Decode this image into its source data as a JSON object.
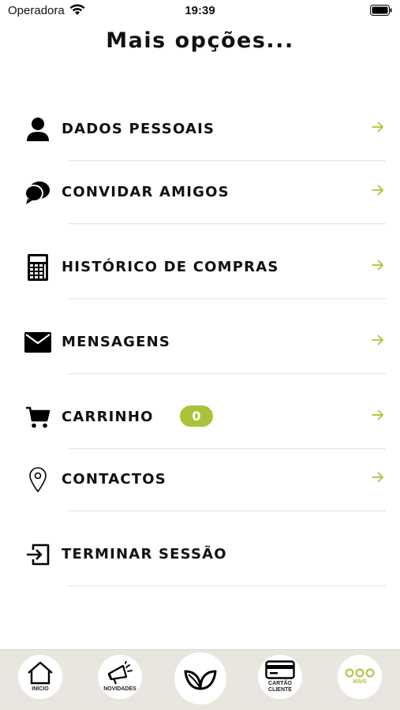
{
  "status_bar": {
    "carrier": "Operadora",
    "time": "19:39"
  },
  "page": {
    "title": "Mais opções..."
  },
  "menu": {
    "items": [
      {
        "label": "DADOS PESSOAIS",
        "icon": "person-icon"
      },
      {
        "label": "CONVIDAR AMIGOS",
        "icon": "chat-bubbles-icon"
      },
      {
        "label": "HISTÓRICO DE COMPRAS",
        "icon": "calculator-icon"
      },
      {
        "label": "MENSAGENS",
        "icon": "envelope-icon"
      },
      {
        "label": "CARRINHO",
        "icon": "cart-icon",
        "badge": "0"
      },
      {
        "label": "CONTACTOS",
        "icon": "map-pin-icon"
      },
      {
        "label": "TERMINAR SESSÃO",
        "icon": "logout-icon"
      }
    ]
  },
  "tabbar": {
    "tabs": [
      {
        "label": "INÍCIO",
        "icon": "home-icon"
      },
      {
        "label": "NOVIDADES",
        "icon": "megaphone-icon"
      },
      {
        "label": "",
        "icon": "leaves-icon"
      },
      {
        "label": "CARTÃO CLIENTE",
        "label_line1": "CARTÃO",
        "label_line2": "CLIENTE",
        "icon": "card-icon"
      },
      {
        "label": "MAIS",
        "icon": "more-circles-icon",
        "active": true
      }
    ]
  },
  "colors": {
    "accent": "#a9c43a",
    "text": "#111111",
    "tabbar_bg": "#e9e6df"
  }
}
